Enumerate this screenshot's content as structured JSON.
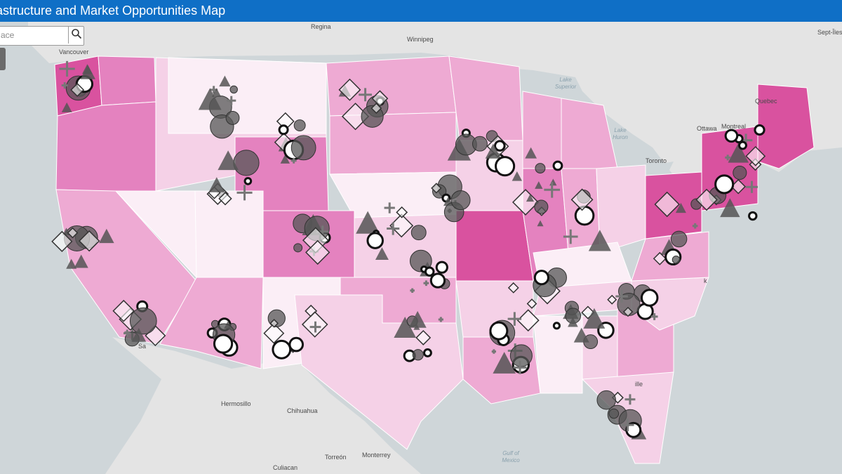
{
  "header": {
    "title": "astructure and Market Opportunities Map"
  },
  "search": {
    "placeholder": "ace"
  },
  "colors": {
    "header": "#0f6fc6",
    "land": "#e3e3e3",
    "water": "#cfd6d9",
    "choropleth_scale": [
      "#fbeef6",
      "#f5d1e7",
      "#eeaad3",
      "#e482bf",
      "#d9529f"
    ]
  },
  "icons": {
    "search": "search-icon",
    "symbols": [
      "circle-marker",
      "ring-marker",
      "triangle-marker",
      "diamond-marker",
      "cross-marker"
    ]
  },
  "place_labels": [
    {
      "id": "regina",
      "text": "Regina"
    },
    {
      "id": "winnipeg",
      "text": "Winnipeg"
    },
    {
      "id": "vancouver",
      "text": "Vancouver"
    },
    {
      "id": "septiles",
      "text": "Sept-Îles"
    },
    {
      "id": "quebec",
      "text": "Quebec"
    },
    {
      "id": "montreal",
      "text": "Montreal"
    },
    {
      "id": "ottawa",
      "text": "Ottawa"
    },
    {
      "id": "toronto",
      "text": "Toronto"
    },
    {
      "id": "hermosillo",
      "text": "Hermosillo"
    },
    {
      "id": "chihuahua",
      "text": "Chihuahua"
    },
    {
      "id": "torreon",
      "text": "Torreón"
    },
    {
      "id": "monterrey",
      "text": "Monterrey"
    },
    {
      "id": "culiacan",
      "text": "Culiacan"
    },
    {
      "id": "sa",
      "text": "Sa"
    },
    {
      "id": "ille",
      "text": "ille"
    },
    {
      "id": "k",
      "text": "k"
    }
  ],
  "water_labels": [
    {
      "id": "lake-superior",
      "text": "Lake Superior"
    },
    {
      "id": "lake-huron",
      "text": "Lake Huron"
    },
    {
      "id": "gulf-of-mexico",
      "text": "Gulf of Mexico"
    }
  ]
}
